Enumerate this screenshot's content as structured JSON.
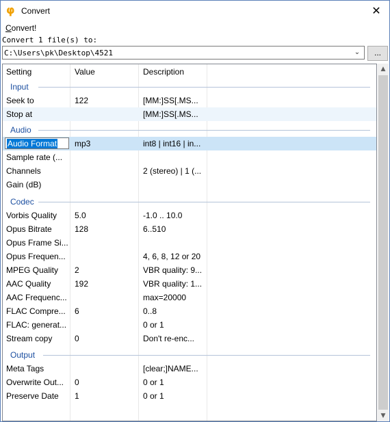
{
  "window": {
    "title": "Convert",
    "app_icon": "phi-icon",
    "close_glyph": "✕"
  },
  "menu": {
    "convert_label_before": "",
    "convert_label_acc": "C",
    "convert_label_after": "onvert!"
  },
  "target": {
    "label": "Convert 1 file(s) to:",
    "path": "C:\\Users\\pk\\Desktop\\4521",
    "browse_label": "..."
  },
  "grid": {
    "columns": [
      "Setting",
      "Value",
      "Description"
    ],
    "groups": [
      {
        "name": "Input",
        "rows": [
          {
            "setting": "Seek to",
            "value": "122",
            "description": "[MM:]SS[.MS..."
          },
          {
            "setting": "Stop at",
            "value": "",
            "description": "[MM:]SS[.MS..."
          }
        ]
      },
      {
        "name": "Audio",
        "rows": [
          {
            "setting": "Audio Format",
            "value": "mp3",
            "description": "int8 | int16 | in..."
          },
          {
            "setting": "Sample rate (...",
            "value": "",
            "description": ""
          },
          {
            "setting": "Channels",
            "value": "",
            "description": "2 (stereo) | 1 (..."
          },
          {
            "setting": "Gain (dB)",
            "value": "",
            "description": ""
          }
        ]
      },
      {
        "name": "Codec",
        "rows": [
          {
            "setting": "Vorbis Quality",
            "value": "5.0",
            "description": "-1.0 .. 10.0"
          },
          {
            "setting": "Opus Bitrate",
            "value": "128",
            "description": "6..510"
          },
          {
            "setting": "Opus Frame Si...",
            "value": "",
            "description": ""
          },
          {
            "setting": "Opus Frequen...",
            "value": "",
            "description": "4, 6, 8, 12 or 20"
          },
          {
            "setting": "MPEG Quality",
            "value": "2",
            "description": "VBR quality: 9..."
          },
          {
            "setting": "AAC Quality",
            "value": "192",
            "description": "VBR quality: 1..."
          },
          {
            "setting": "AAC Frequenc...",
            "value": "",
            "description": "max=20000"
          },
          {
            "setting": "FLAC Compre...",
            "value": "6",
            "description": "0..8"
          },
          {
            "setting": "FLAC: generat...",
            "value": "",
            "description": "0 or 1"
          },
          {
            "setting": "Stream copy",
            "value": "0",
            "description": "Don't re-enc..."
          }
        ]
      },
      {
        "name": "Output",
        "rows": [
          {
            "setting": "Meta Tags",
            "value": "",
            "description": "[clear;]NAME..."
          },
          {
            "setting": "Overwrite Out...",
            "value": "0",
            "description": "0 or 1"
          },
          {
            "setting": "Preserve Date",
            "value": "1",
            "description": "0 or 1"
          }
        ]
      }
    ],
    "selected_row": "Audio Format",
    "hover_row": "Stop at"
  },
  "scrollbar": {
    "up_glyph": "▲",
    "down_glyph": "▼",
    "combo_arrow": "⌄"
  },
  "colors": {
    "accent": "#0078d7",
    "group_text": "#1c4fa0",
    "selection": "#cce4f7",
    "hover": "#edf5fc",
    "icon": "#f0a000"
  }
}
